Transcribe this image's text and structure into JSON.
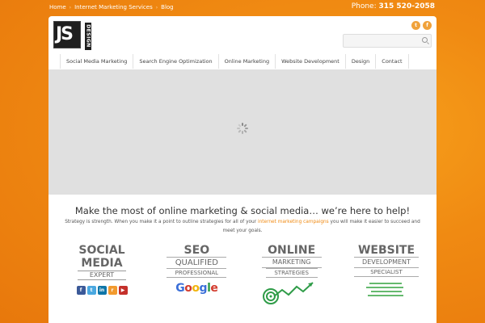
{
  "header": {
    "breadcrumbs": [
      "Home",
      "Internet Marketing Services",
      "Blog"
    ],
    "phone_label": "Phone:",
    "phone_number": "315 520-2058"
  },
  "logo": {
    "text": "JS",
    "sub": "DESIGN"
  },
  "social_icons": [
    {
      "name": "twitter-icon",
      "glyph": "t"
    },
    {
      "name": "facebook-icon",
      "glyph": "f"
    }
  ],
  "search": {
    "placeholder": ""
  },
  "nav": {
    "items": [
      "Social Media Marketing",
      "Search Engine Optimization",
      "Online Marketing",
      "Website Development",
      "Design",
      "Contact"
    ]
  },
  "main": {
    "headline": "Make the most of online marketing & social media… we’re here to help!",
    "intro_before": "Strategy is strength. When you make it a point to outline strategies for all of your ",
    "intro_link": "internet marketing campaigns",
    "intro_after": " you will make it easier to succeed and meet your goals."
  },
  "features": {
    "social": {
      "line1": "SOCIAL",
      "line2": "MEDIA",
      "line3": "EXPERT"
    },
    "seo": {
      "line1": "SEO",
      "line2": "QUALIFIED",
      "line3": "PROFESSIONAL",
      "brand": "Google"
    },
    "online": {
      "line1": "ONLINE",
      "line2": "MARKETING",
      "line3": "STRATEGIES"
    },
    "website": {
      "line1": "WEBSITE",
      "line2": "DEVELOPMENT",
      "line3": "SPECIALIST"
    }
  },
  "colors": {
    "accent": "#f08a12",
    "panel": "#ffffff",
    "slider": "#e0e0e0"
  }
}
